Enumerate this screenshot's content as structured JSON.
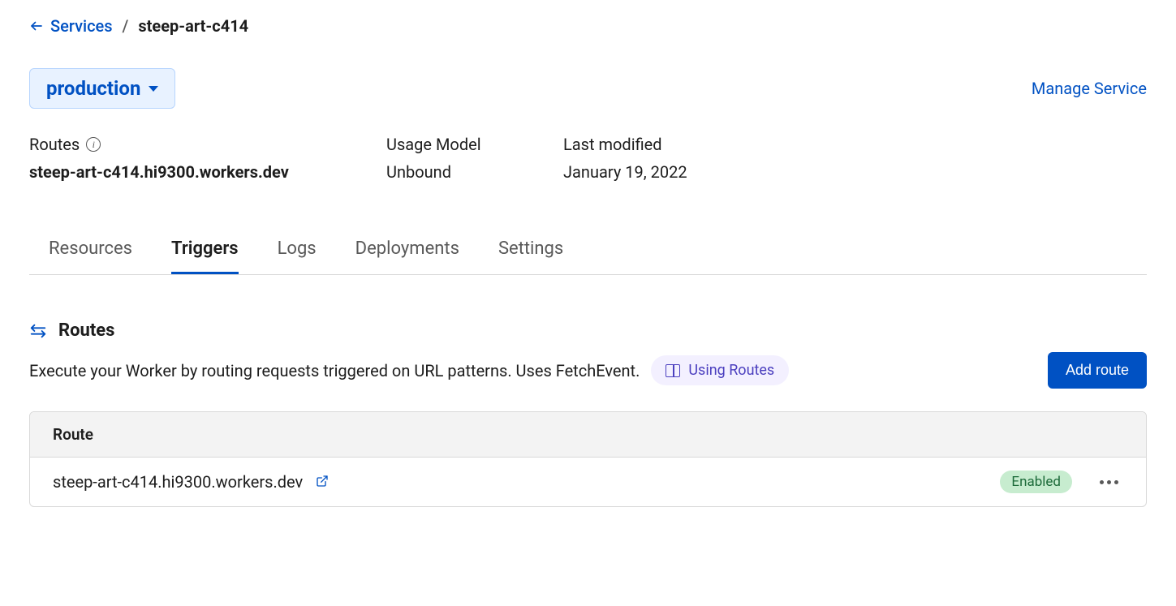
{
  "breadcrumb": {
    "back_label": "Services",
    "current": "steep-art-c414"
  },
  "header": {
    "environment": "production",
    "manage_link": "Manage Service"
  },
  "meta": {
    "routes_label": "Routes",
    "routes_value": "steep-art-c414.hi9300.workers.dev",
    "usage_model_label": "Usage Model",
    "usage_model_value": "Unbound",
    "last_modified_label": "Last modified",
    "last_modified_value": "January 19, 2022"
  },
  "tabs": {
    "items": [
      {
        "label": "Resources"
      },
      {
        "label": "Triggers"
      },
      {
        "label": "Logs"
      },
      {
        "label": "Deployments"
      },
      {
        "label": "Settings"
      }
    ]
  },
  "routes_section": {
    "title": "Routes",
    "description": "Execute your Worker by routing requests triggered on URL patterns. Uses FetchEvent.",
    "docs_link": "Using Routes",
    "add_button": "Add route",
    "table_header": "Route",
    "rows": [
      {
        "route": "steep-art-c414.hi9300.workers.dev",
        "status": "Enabled"
      }
    ]
  }
}
